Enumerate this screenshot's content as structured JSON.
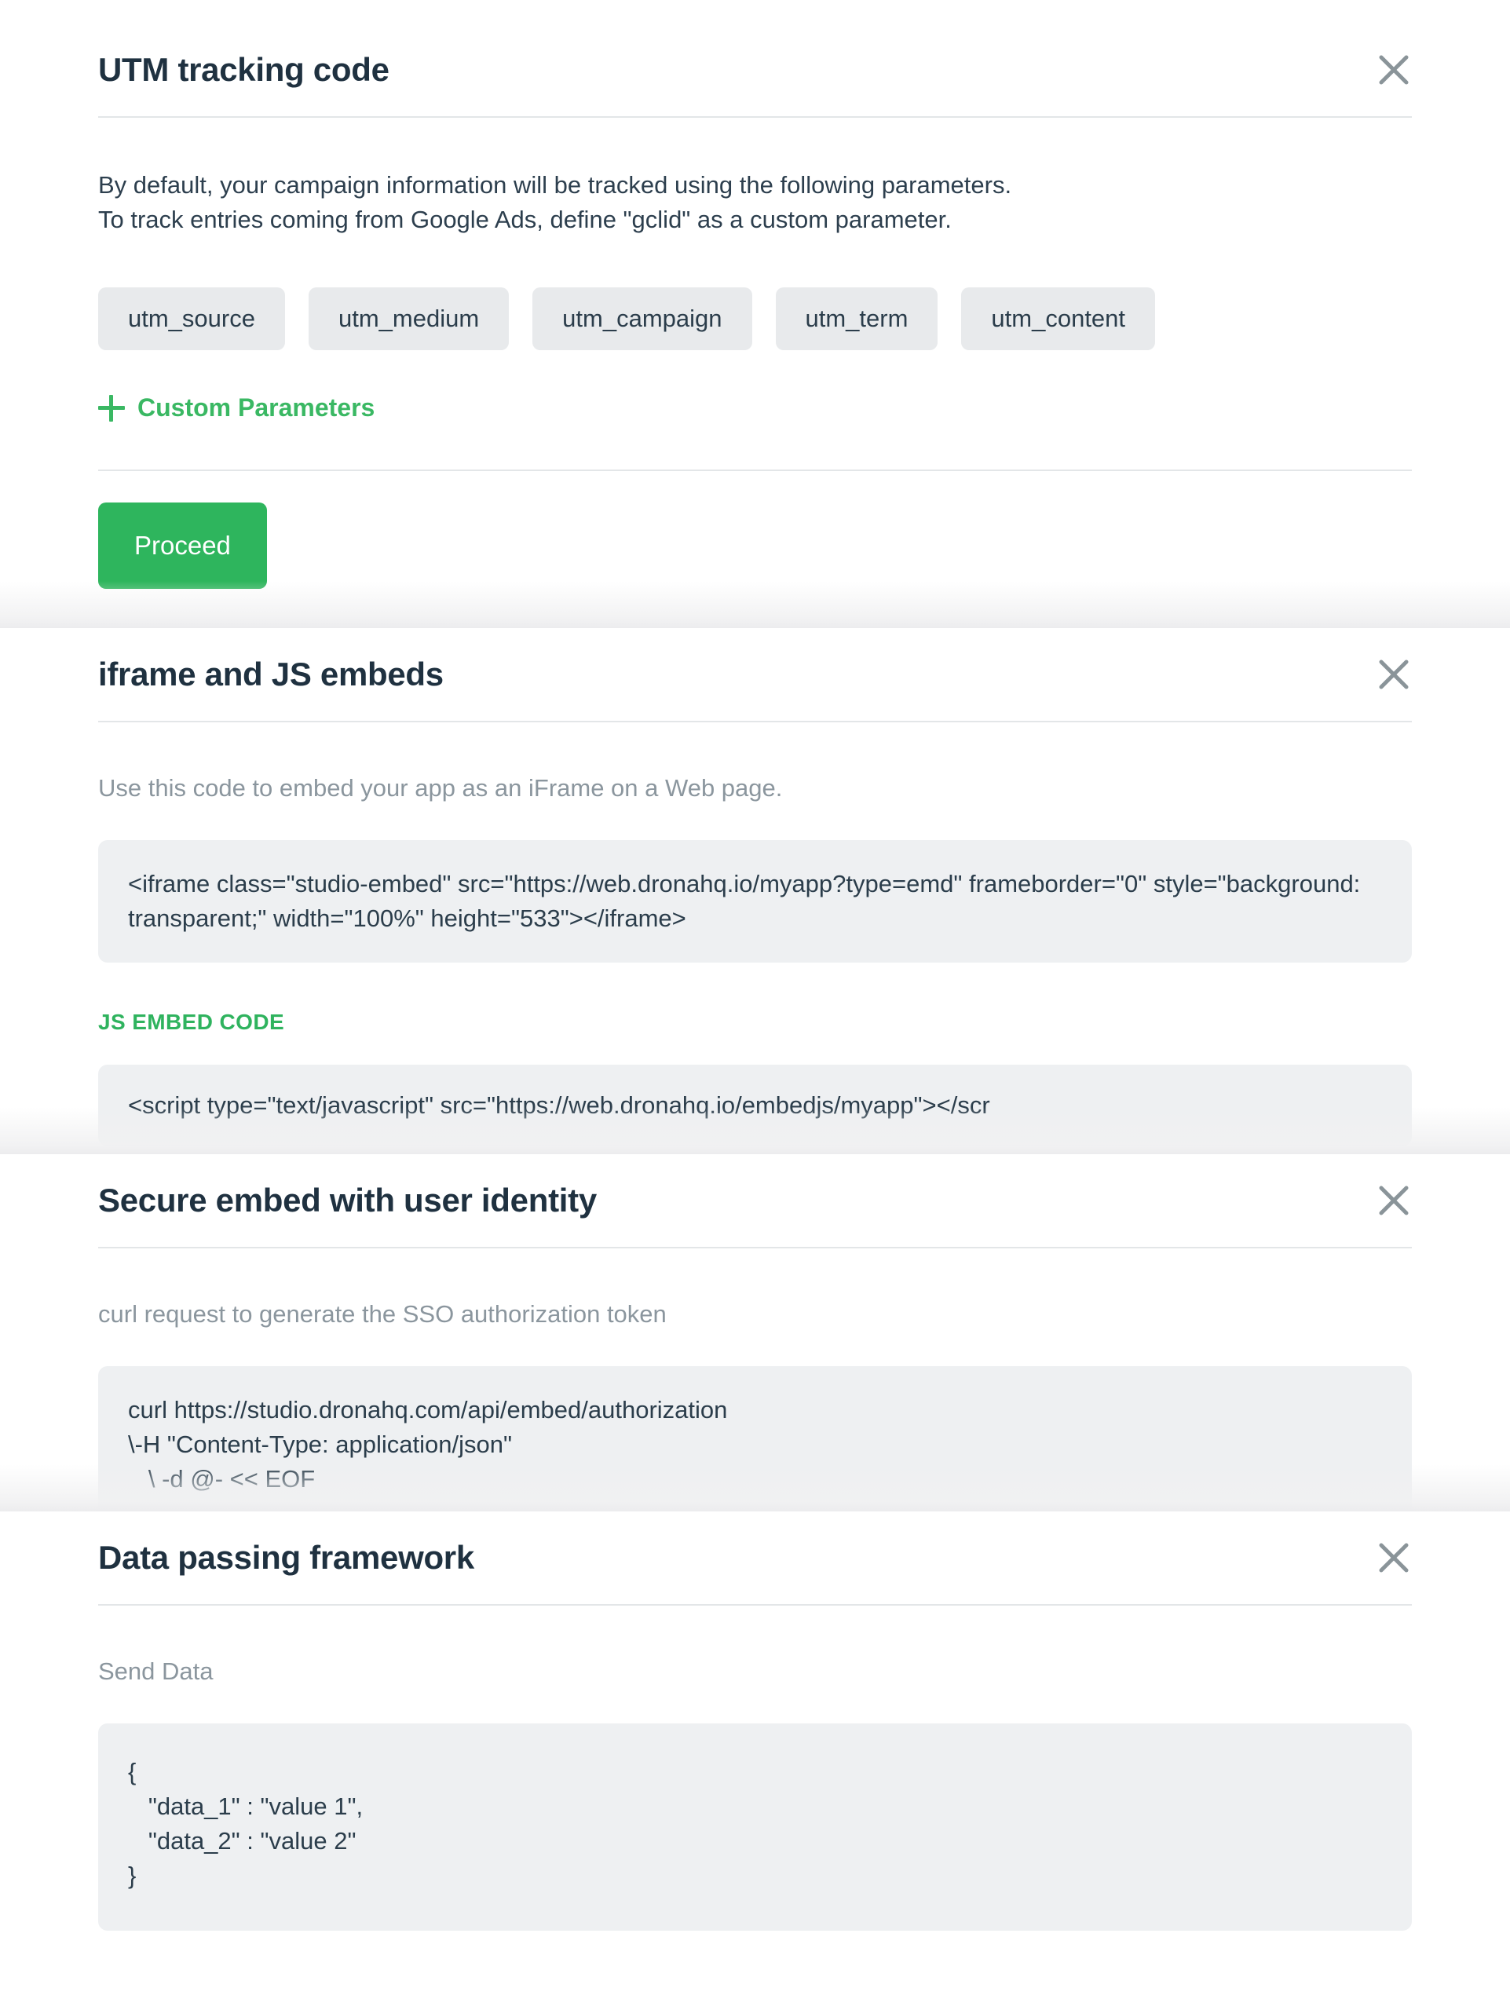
{
  "colors": {
    "accent_green": "#2eb55d",
    "link_green": "#3ab863",
    "label_green": "#2fb35e",
    "title": "#1f3140",
    "code_bg": "#eef0f2",
    "chip_bg": "#e8eaec"
  },
  "panels": [
    {
      "id": "utm-tracking-code",
      "title": "UTM tracking code",
      "close_label": "close-icon",
      "description_line_1": "By default, your campaign information will be tracked using the following parameters.",
      "description_line_2": "To track entries coming from Google Ads, define \"gclid\" as a custom parameter.",
      "chips": [
        "utm_source",
        "utm_medium",
        "utm_campaign",
        "utm_term",
        "utm_content"
      ],
      "add_custom_parameters_label": "Custom Parameters",
      "proceed_label": "Proceed"
    },
    {
      "id": "iframe-and-js-embeds",
      "title": "iframe and JS embeds",
      "close_label": "close-icon",
      "description": "Use this code to embed your app as an iFrame on a Web page.",
      "iframe_code": "<iframe class=\"studio-embed\" src=\"https://web.dronahq.io/myapp?type=emd\" frameborder=\"0\" style=\"background: transparent;\" width=\"100%\" height=\"533\"></iframe>",
      "js_embed_label": "JS EMBED CODE",
      "js_embed_code": "<script type=\"text/javascript\" src=\"https://web.dronahq.io/embedjs/myapp\"></scr"
    },
    {
      "id": "secure-embed-with-user-identity",
      "title": "Secure embed with user identity",
      "close_label": "close-icon",
      "description": "curl request to generate the SSO authorization token",
      "curl_code": "curl https://studio.dronahq.com/api/embed/authorization\n\\-H \"Content-Type: application/json\"\n   \\ -d @- << EOF"
    },
    {
      "id": "data-passing-framework",
      "title": "Data passing framework",
      "close_label": "close-icon",
      "description": "Send Data",
      "json_code": "{\n   \"data_1\" : \"value 1\",\n   \"data_2\" : \"value 2\"\n}"
    }
  ]
}
